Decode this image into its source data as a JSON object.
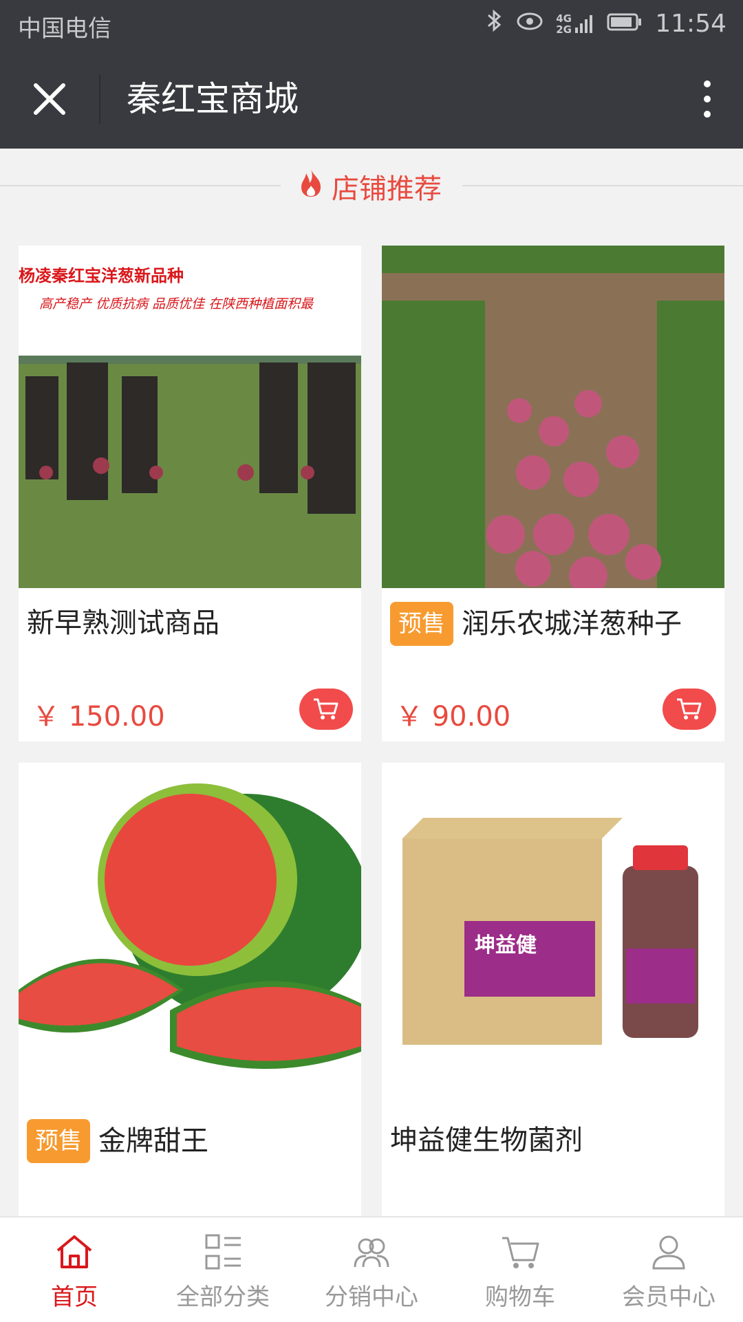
{
  "status_bar": {
    "carrier": "中国电信",
    "network": "4G 2G",
    "time": "11:54"
  },
  "nav": {
    "title": "秦红宝商城"
  },
  "section": {
    "title": "店铺推荐"
  },
  "products": [
    {
      "name": "新早熟测试商品",
      "price": "￥ 150.00",
      "tag": "",
      "image": "onion-farmers-photo",
      "banner_line1": "杨凌秦红宝洋葱新品种",
      "banner_line2": "高产稳产 优质抗病 品质优佳 在陕西种植面积最"
    },
    {
      "name": "润乐农城洋葱种子",
      "price": "￥ 90.00",
      "tag": "预售",
      "image": "onion-field-photo"
    },
    {
      "name": "金牌甜王",
      "price": "",
      "tag": "预售",
      "image": "watermelon-photo"
    },
    {
      "name": "坤益健生物菌剂",
      "price": "",
      "tag": "",
      "image": "fertilizer-box-photo",
      "label_brand": "坤益健"
    }
  ],
  "tabs": [
    {
      "label": "首页",
      "icon": "home-icon",
      "active": true
    },
    {
      "label": "全部分类",
      "icon": "category-icon",
      "active": false
    },
    {
      "label": "分销中心",
      "icon": "distribution-icon",
      "active": false
    },
    {
      "label": "购物车",
      "icon": "cart-icon",
      "active": false
    },
    {
      "label": "会员中心",
      "icon": "user-icon",
      "active": false
    }
  ],
  "colors": {
    "accent": "#e84a3f",
    "presale": "#f79b30",
    "header": "#393a3f",
    "tab_active": "#d9171b"
  }
}
